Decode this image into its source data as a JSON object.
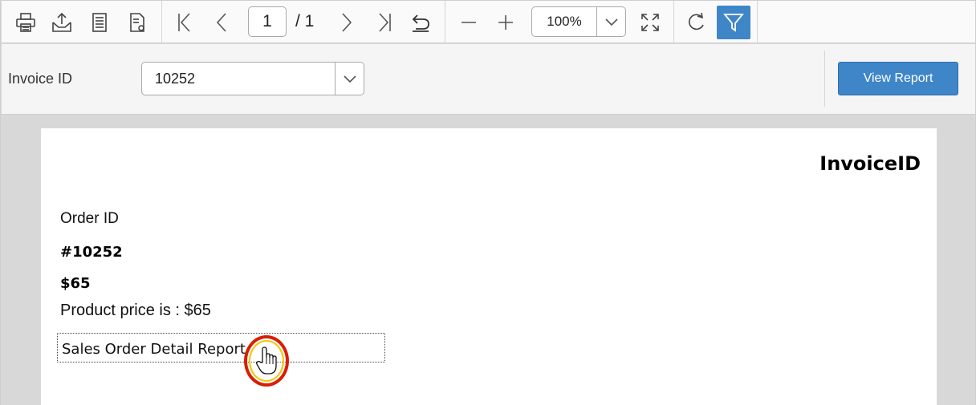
{
  "toolbar": {
    "icons": [
      "print-icon",
      "export-icon",
      "page-setup-icon",
      "print-layout-icon",
      "first-page-icon",
      "previous-page-icon",
      "next-page-icon",
      "last-page-icon",
      "undo-icon",
      "zoom-out-icon",
      "zoom-in-icon",
      "fit-page-icon",
      "refresh-icon",
      "filter-icon"
    ],
    "current_page": "1",
    "total_pages": "/ 1",
    "zoom": "100%",
    "accent": "#3f86c8"
  },
  "parameters": {
    "invoice_label": "Invoice ID",
    "invoice_value": "10252",
    "view_button": "View Report"
  },
  "report": {
    "title": "InvoiceID",
    "order_label": "Order ID",
    "order_id": "#10252",
    "amount": "$65",
    "price_line": "Product price is : $65",
    "link_text": "Sales Order Detail Report"
  }
}
